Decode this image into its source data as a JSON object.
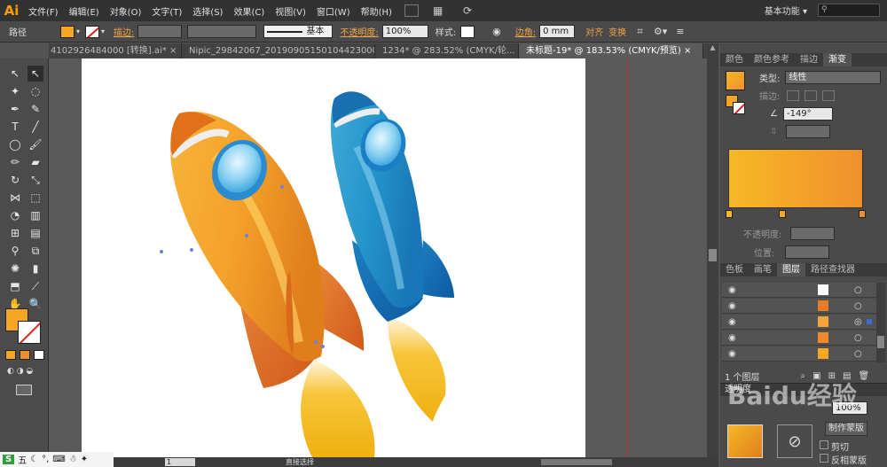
{
  "app": {
    "logo": "Ai",
    "workspace": "基本功能",
    "workspace_caret": "▾"
  },
  "menu": [
    "文件(F)",
    "编辑(E)",
    "对象(O)",
    "文字(T)",
    "选择(S)",
    "效果(C)",
    "视图(V)",
    "窗口(W)",
    "帮助(H)"
  ],
  "control": {
    "object_type": "路径",
    "stroke_label": "描边:",
    "stroke_profile": "基本",
    "opacity_label": "不透明度:",
    "opacity_value": "100%",
    "style_label": "样式:",
    "corner_label": "边角:",
    "corner_value": "0 mm",
    "align_label": "对齐",
    "transform_label": "变换",
    "fill_color": "#f5a623"
  },
  "tabs": [
    {
      "label": "4102926484000 [转换].ai*",
      "active": false
    },
    {
      "label": "Nipic_29842067_20190905150104423000.ai*",
      "active": false
    },
    {
      "label": "1234* @ 283.52% (CMYK/轮...",
      "active": false
    },
    {
      "label": "未标题-19* @ 183.53% (CMYK/预览)",
      "active": true
    }
  ],
  "gradient_panel": {
    "tabs": [
      "颜色",
      "颜色参考",
      "描边",
      "渐变"
    ],
    "active_tab": "渐变",
    "type_label": "类型:",
    "type_value": "线性",
    "stroke_label": "描边:",
    "angle_value": "-149°",
    "opacity_label": "不透明度:",
    "position_label": "位置:",
    "gradient_start": "#f6b826",
    "gradient_end": "#f0902c"
  },
  "layers_panel": {
    "tabs": [
      "色板",
      "画笔",
      "图层",
      "路径查找器"
    ],
    "active_tab": "图层",
    "footer": "1 个图层"
  },
  "bottom_panel": {
    "title": "透明度",
    "opacity_value": "100%",
    "button_label": "制作蒙版",
    "clip_label": "剪切",
    "invert_label": "反相蒙版"
  },
  "status": {
    "mode_text": "直接选择",
    "zoom_text": "1"
  },
  "ime": {
    "letter": "S",
    "lang": "五"
  },
  "watermark": "Baidu经验"
}
